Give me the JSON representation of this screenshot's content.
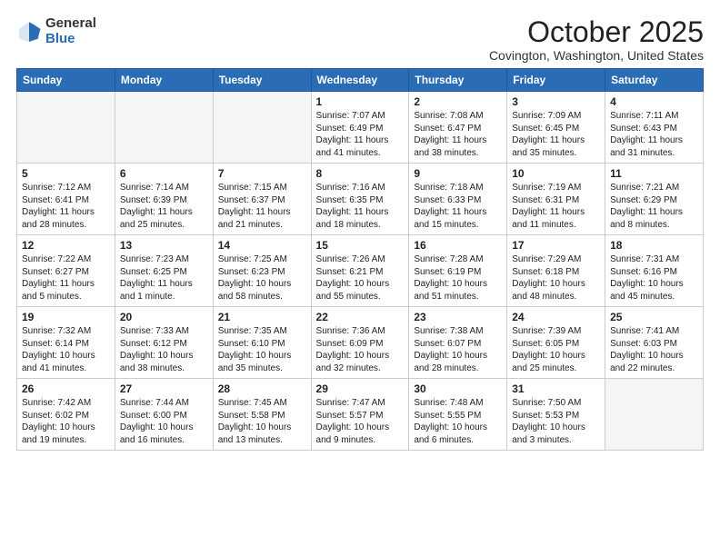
{
  "header": {
    "logo_general": "General",
    "logo_blue": "Blue",
    "month_title": "October 2025",
    "subtitle": "Covington, Washington, United States"
  },
  "days_of_week": [
    "Sunday",
    "Monday",
    "Tuesday",
    "Wednesday",
    "Thursday",
    "Friday",
    "Saturday"
  ],
  "weeks": [
    [
      {
        "num": "",
        "sunrise": "",
        "sunset": "",
        "daylight": "",
        "empty": true
      },
      {
        "num": "",
        "sunrise": "",
        "sunset": "",
        "daylight": "",
        "empty": true
      },
      {
        "num": "",
        "sunrise": "",
        "sunset": "",
        "daylight": "",
        "empty": true
      },
      {
        "num": "1",
        "sunrise": "Sunrise: 7:07 AM",
        "sunset": "Sunset: 6:49 PM",
        "daylight": "Daylight: 11 hours and 41 minutes."
      },
      {
        "num": "2",
        "sunrise": "Sunrise: 7:08 AM",
        "sunset": "Sunset: 6:47 PM",
        "daylight": "Daylight: 11 hours and 38 minutes."
      },
      {
        "num": "3",
        "sunrise": "Sunrise: 7:09 AM",
        "sunset": "Sunset: 6:45 PM",
        "daylight": "Daylight: 11 hours and 35 minutes."
      },
      {
        "num": "4",
        "sunrise": "Sunrise: 7:11 AM",
        "sunset": "Sunset: 6:43 PM",
        "daylight": "Daylight: 11 hours and 31 minutes."
      }
    ],
    [
      {
        "num": "5",
        "sunrise": "Sunrise: 7:12 AM",
        "sunset": "Sunset: 6:41 PM",
        "daylight": "Daylight: 11 hours and 28 minutes."
      },
      {
        "num": "6",
        "sunrise": "Sunrise: 7:14 AM",
        "sunset": "Sunset: 6:39 PM",
        "daylight": "Daylight: 11 hours and 25 minutes."
      },
      {
        "num": "7",
        "sunrise": "Sunrise: 7:15 AM",
        "sunset": "Sunset: 6:37 PM",
        "daylight": "Daylight: 11 hours and 21 minutes."
      },
      {
        "num": "8",
        "sunrise": "Sunrise: 7:16 AM",
        "sunset": "Sunset: 6:35 PM",
        "daylight": "Daylight: 11 hours and 18 minutes."
      },
      {
        "num": "9",
        "sunrise": "Sunrise: 7:18 AM",
        "sunset": "Sunset: 6:33 PM",
        "daylight": "Daylight: 11 hours and 15 minutes."
      },
      {
        "num": "10",
        "sunrise": "Sunrise: 7:19 AM",
        "sunset": "Sunset: 6:31 PM",
        "daylight": "Daylight: 11 hours and 11 minutes."
      },
      {
        "num": "11",
        "sunrise": "Sunrise: 7:21 AM",
        "sunset": "Sunset: 6:29 PM",
        "daylight": "Daylight: 11 hours and 8 minutes."
      }
    ],
    [
      {
        "num": "12",
        "sunrise": "Sunrise: 7:22 AM",
        "sunset": "Sunset: 6:27 PM",
        "daylight": "Daylight: 11 hours and 5 minutes."
      },
      {
        "num": "13",
        "sunrise": "Sunrise: 7:23 AM",
        "sunset": "Sunset: 6:25 PM",
        "daylight": "Daylight: 11 hours and 1 minute."
      },
      {
        "num": "14",
        "sunrise": "Sunrise: 7:25 AM",
        "sunset": "Sunset: 6:23 PM",
        "daylight": "Daylight: 10 hours and 58 minutes."
      },
      {
        "num": "15",
        "sunrise": "Sunrise: 7:26 AM",
        "sunset": "Sunset: 6:21 PM",
        "daylight": "Daylight: 10 hours and 55 minutes."
      },
      {
        "num": "16",
        "sunrise": "Sunrise: 7:28 AM",
        "sunset": "Sunset: 6:19 PM",
        "daylight": "Daylight: 10 hours and 51 minutes."
      },
      {
        "num": "17",
        "sunrise": "Sunrise: 7:29 AM",
        "sunset": "Sunset: 6:18 PM",
        "daylight": "Daylight: 10 hours and 48 minutes."
      },
      {
        "num": "18",
        "sunrise": "Sunrise: 7:31 AM",
        "sunset": "Sunset: 6:16 PM",
        "daylight": "Daylight: 10 hours and 45 minutes."
      }
    ],
    [
      {
        "num": "19",
        "sunrise": "Sunrise: 7:32 AM",
        "sunset": "Sunset: 6:14 PM",
        "daylight": "Daylight: 10 hours and 41 minutes."
      },
      {
        "num": "20",
        "sunrise": "Sunrise: 7:33 AM",
        "sunset": "Sunset: 6:12 PM",
        "daylight": "Daylight: 10 hours and 38 minutes."
      },
      {
        "num": "21",
        "sunrise": "Sunrise: 7:35 AM",
        "sunset": "Sunset: 6:10 PM",
        "daylight": "Daylight: 10 hours and 35 minutes."
      },
      {
        "num": "22",
        "sunrise": "Sunrise: 7:36 AM",
        "sunset": "Sunset: 6:09 PM",
        "daylight": "Daylight: 10 hours and 32 minutes."
      },
      {
        "num": "23",
        "sunrise": "Sunrise: 7:38 AM",
        "sunset": "Sunset: 6:07 PM",
        "daylight": "Daylight: 10 hours and 28 minutes."
      },
      {
        "num": "24",
        "sunrise": "Sunrise: 7:39 AM",
        "sunset": "Sunset: 6:05 PM",
        "daylight": "Daylight: 10 hours and 25 minutes."
      },
      {
        "num": "25",
        "sunrise": "Sunrise: 7:41 AM",
        "sunset": "Sunset: 6:03 PM",
        "daylight": "Daylight: 10 hours and 22 minutes."
      }
    ],
    [
      {
        "num": "26",
        "sunrise": "Sunrise: 7:42 AM",
        "sunset": "Sunset: 6:02 PM",
        "daylight": "Daylight: 10 hours and 19 minutes."
      },
      {
        "num": "27",
        "sunrise": "Sunrise: 7:44 AM",
        "sunset": "Sunset: 6:00 PM",
        "daylight": "Daylight: 10 hours and 16 minutes."
      },
      {
        "num": "28",
        "sunrise": "Sunrise: 7:45 AM",
        "sunset": "Sunset: 5:58 PM",
        "daylight": "Daylight: 10 hours and 13 minutes."
      },
      {
        "num": "29",
        "sunrise": "Sunrise: 7:47 AM",
        "sunset": "Sunset: 5:57 PM",
        "daylight": "Daylight: 10 hours and 9 minutes."
      },
      {
        "num": "30",
        "sunrise": "Sunrise: 7:48 AM",
        "sunset": "Sunset: 5:55 PM",
        "daylight": "Daylight: 10 hours and 6 minutes."
      },
      {
        "num": "31",
        "sunrise": "Sunrise: 7:50 AM",
        "sunset": "Sunset: 5:53 PM",
        "daylight": "Daylight: 10 hours and 3 minutes."
      },
      {
        "num": "",
        "sunrise": "",
        "sunset": "",
        "daylight": "",
        "empty": true
      }
    ]
  ]
}
